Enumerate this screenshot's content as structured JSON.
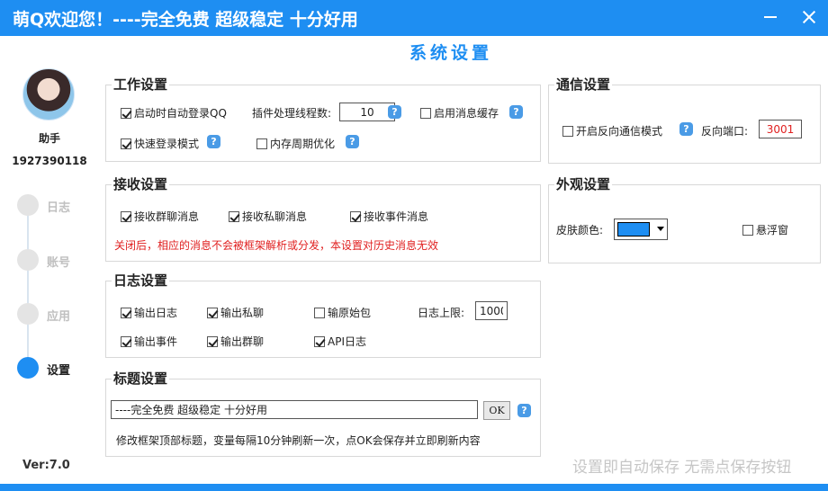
{
  "window": {
    "title": "萌Q欢迎您！----完全免费 超级稳定 十分好用"
  },
  "page_title": "系统设置",
  "user": {
    "name": "助手",
    "qq": "1927390118"
  },
  "nav": [
    {
      "label": "日志",
      "active": false
    },
    {
      "label": "账号",
      "active": false
    },
    {
      "label": "应用",
      "active": false
    },
    {
      "label": "设置",
      "active": true
    }
  ],
  "version": "Ver:7.0",
  "work": {
    "title": "工作设置",
    "auto_login": {
      "label": "启动时自动登录QQ",
      "checked": true
    },
    "threads_label": "插件处理线程数:",
    "threads_value": "10",
    "msg_cache": {
      "label": "启用消息缓存",
      "checked": false
    },
    "fast_login": {
      "label": "快速登录模式",
      "checked": true
    },
    "mem_opt": {
      "label": "内存周期优化",
      "checked": false
    }
  },
  "receive": {
    "title": "接收设置",
    "group_msg": {
      "label": "接收群聊消息",
      "checked": true
    },
    "private_msg": {
      "label": "接收私聊消息",
      "checked": true
    },
    "event_msg": {
      "label": "接收事件消息",
      "checked": true
    },
    "note": "关闭后，相应的消息不会被框架解析或分发，本设置对历史消息无效"
  },
  "log": {
    "title": "日志设置",
    "out_log": {
      "label": "输出日志",
      "checked": true
    },
    "out_private": {
      "label": "输出私聊",
      "checked": true
    },
    "out_raw": {
      "label": "输原始包",
      "checked": false
    },
    "limit_label": "日志上限:",
    "limit_value": "1000",
    "out_event": {
      "label": "输出事件",
      "checked": true
    },
    "out_group": {
      "label": "输出群聊",
      "checked": true
    },
    "api_log": {
      "label": "API日志",
      "checked": true
    }
  },
  "title_settings": {
    "title": "标题设置",
    "value": "----完全免费 超级稳定 十分好用",
    "ok_label": "OK",
    "note": "修改框架顶部标题，变量每隔10分钟刷新一次，点OK会保存并立即刷新内容"
  },
  "comm": {
    "title": "通信设置",
    "reverse": {
      "label": "开启反向通信模式",
      "checked": false
    },
    "port_label": "反向端口:",
    "port_value": "3001"
  },
  "appearance": {
    "title": "外观设置",
    "skin_label": "皮肤颜色:",
    "skin_color": "#1e8ef2",
    "float": {
      "label": "悬浮窗",
      "checked": false
    }
  },
  "help_glyph": "?",
  "autosave_note": "设置即自动保存 无需点保存按钮"
}
